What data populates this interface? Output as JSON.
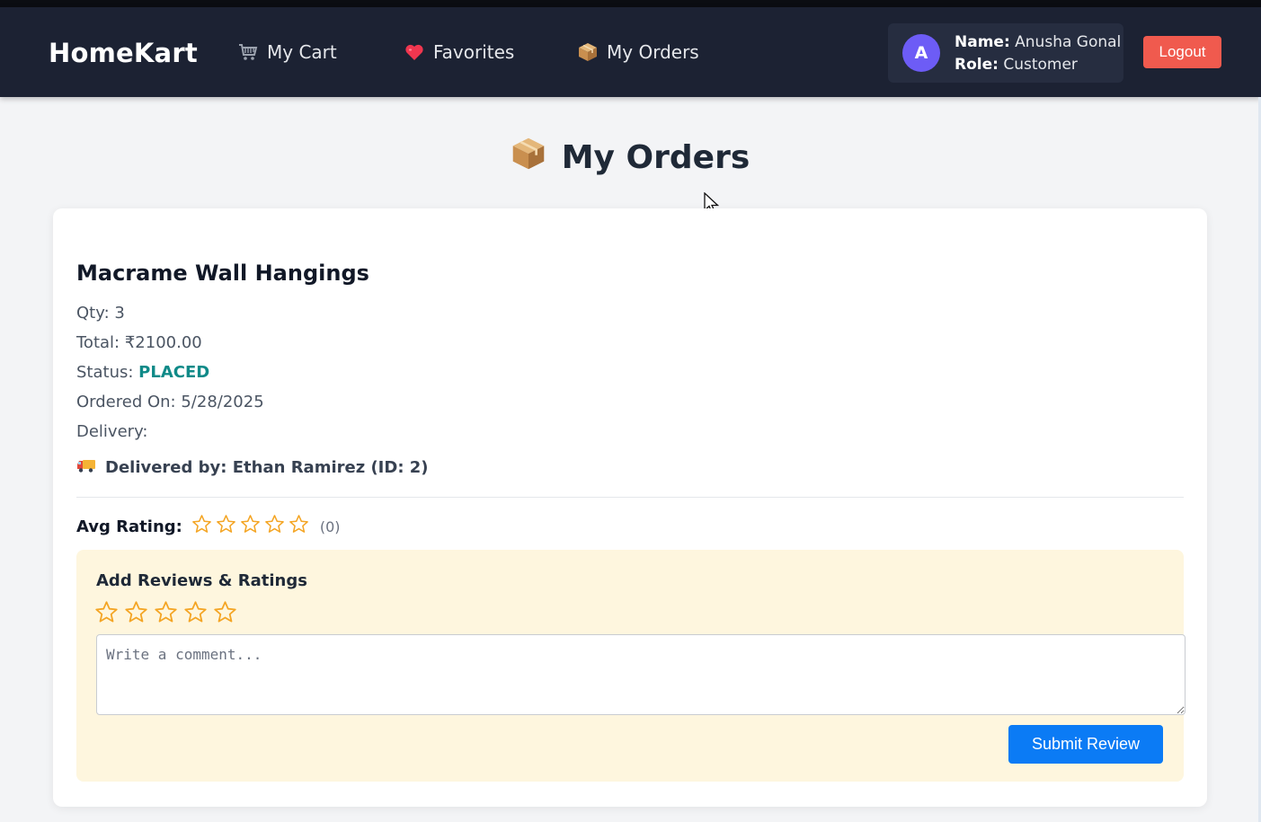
{
  "navbar": {
    "brand": "HomeKart",
    "links": [
      {
        "label": "My Cart",
        "icon": "cart-icon"
      },
      {
        "label": "Favorites",
        "icon": "heart-icon"
      },
      {
        "label": "My Orders",
        "icon": "package-icon"
      }
    ],
    "user": {
      "avatar_letter": "A",
      "name_label": "Name:",
      "name": "Anusha Gonal",
      "role_label": "Role:",
      "role": "Customer"
    },
    "logout_label": "Logout"
  },
  "page": {
    "title": "My Orders",
    "title_icon": "package-icon"
  },
  "order": {
    "product_name": "Macrame Wall Hangings",
    "qty_label": "Qty:",
    "qty": "3",
    "total_label": "Total:",
    "total": "₹2100.00",
    "status_label": "Status:",
    "status": "PLACED",
    "ordered_on_label": "Ordered On:",
    "ordered_on": "5/28/2025",
    "delivery_label": "Delivery:",
    "delivered_by": "Delivered by: Ethan Ramirez (ID: 2)",
    "delivered_icon": "truck-icon"
  },
  "rating": {
    "avg_label": "Avg Rating:",
    "avg_stars": 0,
    "count_text": "(0)"
  },
  "review": {
    "title": "Add Reviews & Ratings",
    "selected_stars": 0,
    "comment_placeholder": "Write a comment...",
    "comment_value": "",
    "submit_label": "Submit Review"
  },
  "colors": {
    "navbar_bg": "#1c2233",
    "status": "#0f8a88",
    "star": "#f4a524",
    "logout": "#f05a4e",
    "submit": "#0b7bf5",
    "review_bg": "#fef6de"
  }
}
